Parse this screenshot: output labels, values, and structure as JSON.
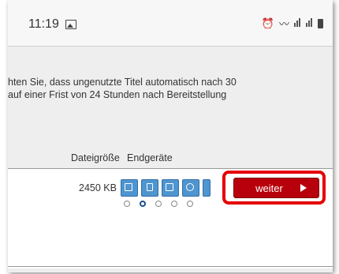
{
  "status_bar": {
    "time": "11:19",
    "icons": [
      "gallery-icon",
      "alarm-icon",
      "wifi-icon",
      "signal-icon",
      "signal-icon",
      "battery-icon"
    ]
  },
  "notice": {
    "line1": "hten Sie, dass ungenutzte Titel automatisch nach 30",
    "line2": "auf einer Frist von 24 Stunden nach Bereitstellung"
  },
  "table": {
    "headers": {
      "file_size": "Dateigröße",
      "devices": "Endgeräte"
    },
    "row": {
      "file_size": "2450 KB",
      "device_icons": [
        "laptop-icon",
        "tablet-icon",
        "phone-icon",
        "globe-icon",
        "device-icon"
      ],
      "selected_device_index": 1
    }
  },
  "actions": {
    "next_label": "weiter"
  },
  "colors": {
    "button_red": "#b8000c",
    "highlight_red": "#e50000",
    "device_blue": "#4f95cf"
  }
}
